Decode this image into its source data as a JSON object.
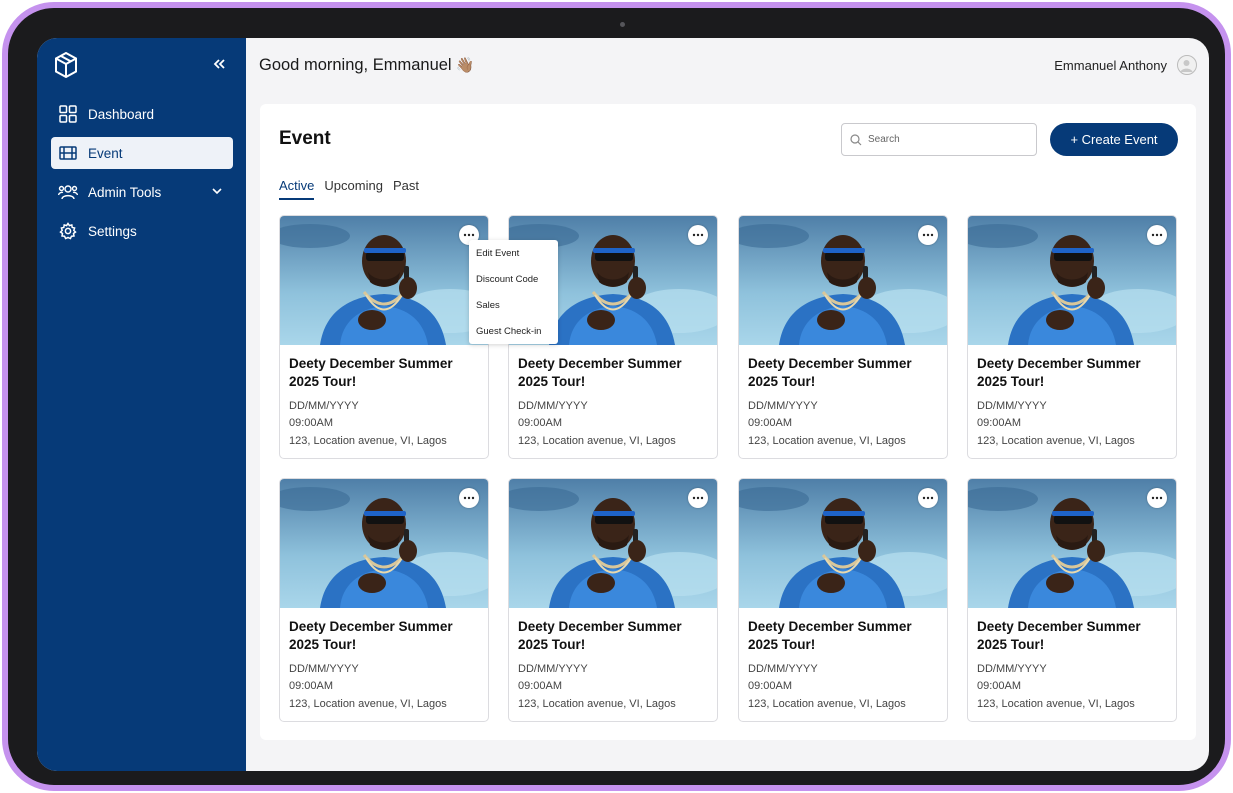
{
  "colors": {
    "brand": "#063a78",
    "device_frame": "#c592ee"
  },
  "sidebar": {
    "collapse_icon": "chevrons-left-icon",
    "items": [
      {
        "label": "Dashboard",
        "icon": "grid-icon",
        "active": false
      },
      {
        "label": "Event",
        "icon": "film-icon",
        "active": true
      },
      {
        "label": "Admin Tools",
        "icon": "users-icon",
        "active": false,
        "has_chevron": true
      },
      {
        "label": "Settings",
        "icon": "gear-icon",
        "active": false
      }
    ]
  },
  "header": {
    "greeting": "Good morning, Emmanuel",
    "wave_emoji": "👋🏽",
    "user_name": "Emmanuel Anthony"
  },
  "main": {
    "title": "Event",
    "search_placeholder": "Search",
    "create_button": "+ Create Event",
    "tabs": [
      {
        "label": "Active",
        "active": true
      },
      {
        "label": "Upcoming",
        "active": false
      },
      {
        "label": "Past",
        "active": false
      }
    ],
    "events": [
      {
        "title": "Deety December Summer 2025 Tour!",
        "date": "DD/MM/YYYY",
        "time": "09:00AM",
        "location": "123, Location avenue, VI, Lagos"
      },
      {
        "title": "Deety December Summer 2025 Tour!",
        "date": "DD/MM/YYYY",
        "time": "09:00AM",
        "location": "123, Location avenue, VI, Lagos"
      },
      {
        "title": "Deety December Summer 2025 Tour!",
        "date": "DD/MM/YYYY",
        "time": "09:00AM",
        "location": "123, Location avenue, VI, Lagos"
      },
      {
        "title": "Deety December Summer 2025 Tour!",
        "date": "DD/MM/YYYY",
        "time": "09:00AM",
        "location": "123, Location avenue, VI, Lagos"
      },
      {
        "title": "Deety December Summer 2025 Tour!",
        "date": "DD/MM/YYYY",
        "time": "09:00AM",
        "location": "123, Location avenue, VI, Lagos"
      },
      {
        "title": "Deety December Summer 2025 Tour!",
        "date": "DD/MM/YYYY",
        "time": "09:00AM",
        "location": "123, Location avenue, VI, Lagos"
      },
      {
        "title": "Deety December Summer 2025 Tour!",
        "date": "DD/MM/YYYY",
        "time": "09:00AM",
        "location": "123, Location avenue, VI, Lagos"
      },
      {
        "title": "Deety December Summer 2025 Tour!",
        "date": "DD/MM/YYYY",
        "time": "09:00AM",
        "location": "123, Location avenue, VI, Lagos"
      }
    ],
    "context_menu": [
      "Edit Event",
      "Discount Code",
      "Sales",
      "Guest Check-in"
    ]
  }
}
